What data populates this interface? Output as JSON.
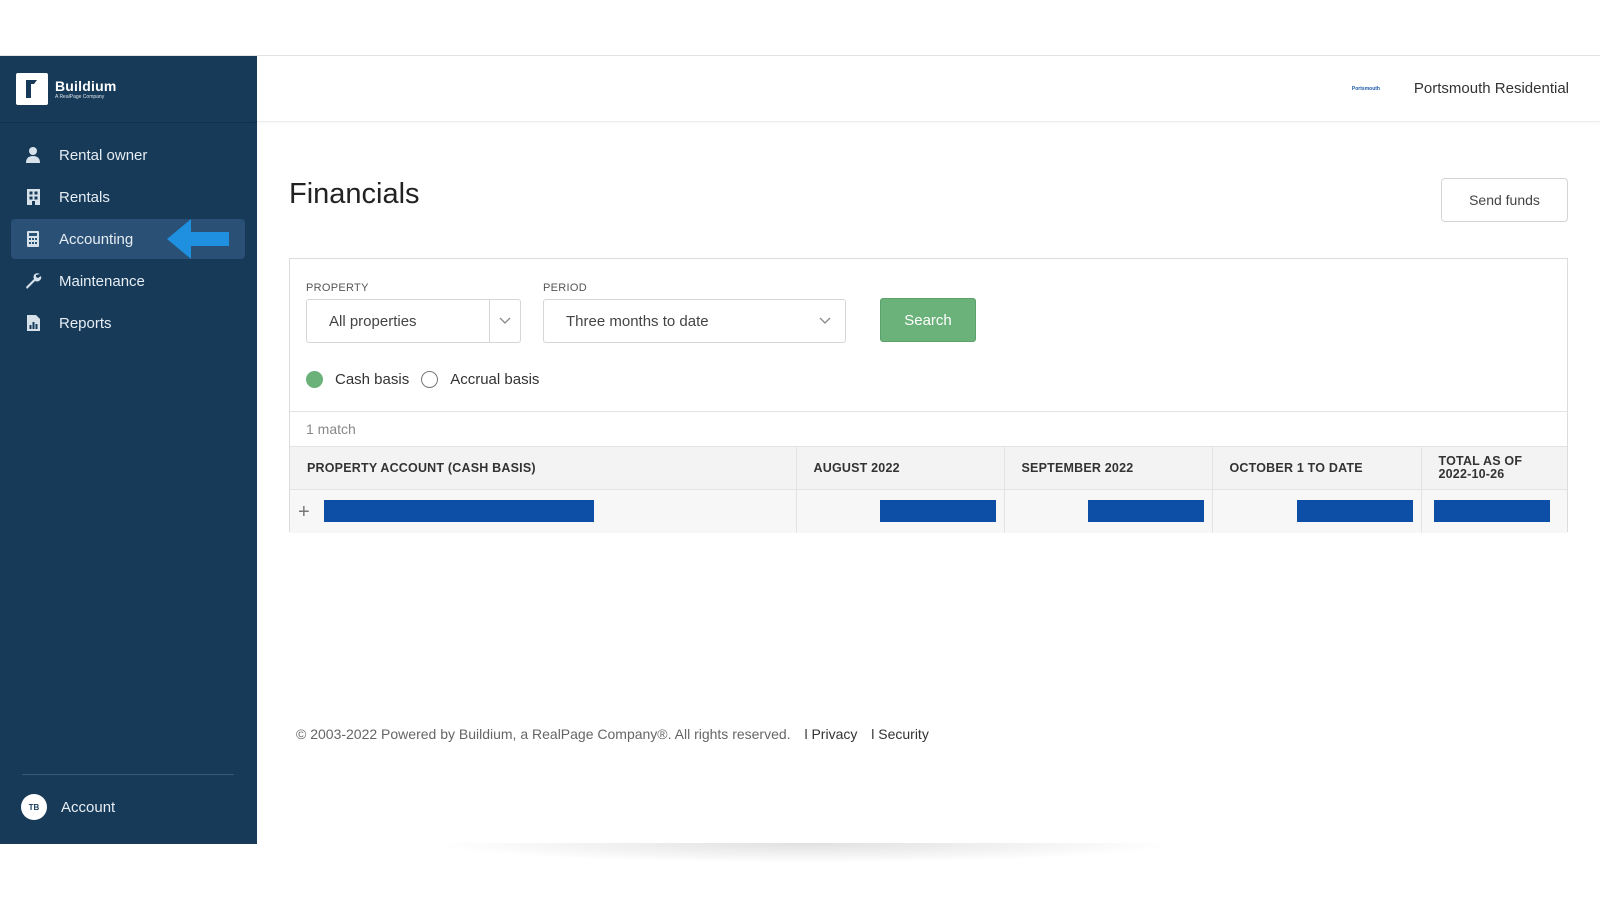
{
  "brand": {
    "name": "Buildium",
    "sub": "A RealPage Company"
  },
  "sidebar": {
    "items": [
      {
        "label": "Rental owner",
        "icon": "person-icon"
      },
      {
        "label": "Rentals",
        "icon": "building-icon"
      },
      {
        "label": "Accounting",
        "icon": "calculator-icon",
        "active": true
      },
      {
        "label": "Maintenance",
        "icon": "wrench-icon"
      },
      {
        "label": "Reports",
        "icon": "report-icon"
      }
    ],
    "account": {
      "initials": "TB",
      "label": "Account"
    }
  },
  "header": {
    "org_logo_text": "Portsmouth",
    "org_name": "Portsmouth Residential"
  },
  "main": {
    "title": "Financials",
    "send_funds_label": "Send funds",
    "filters": {
      "property_label": "PROPERTY",
      "property_value": "All properties",
      "period_label": "PERIOD",
      "period_value": "Three months to date",
      "search_label": "Search",
      "basis_options": [
        "Cash basis",
        "Accrual basis"
      ],
      "selected_basis": "Cash basis"
    },
    "match_count": "1 match",
    "table": {
      "columns": [
        "PROPERTY ACCOUNT (CASH BASIS)",
        "AUGUST 2022",
        "SEPTEMBER 2022",
        "OCTOBER 1 TO DATE",
        "TOTAL AS OF 2022-10-26"
      ]
    }
  },
  "footer": {
    "copyright": "© 2003-2022 Powered by Buildium, a RealPage Company®. All rights reserved.",
    "privacy": "l Privacy",
    "security": "l Security"
  },
  "colors": {
    "sidebar": "#173a58",
    "accent_green": "#6ab27a",
    "arrow_blue": "#1f8fe0",
    "redaction": "#0d4ea6"
  }
}
